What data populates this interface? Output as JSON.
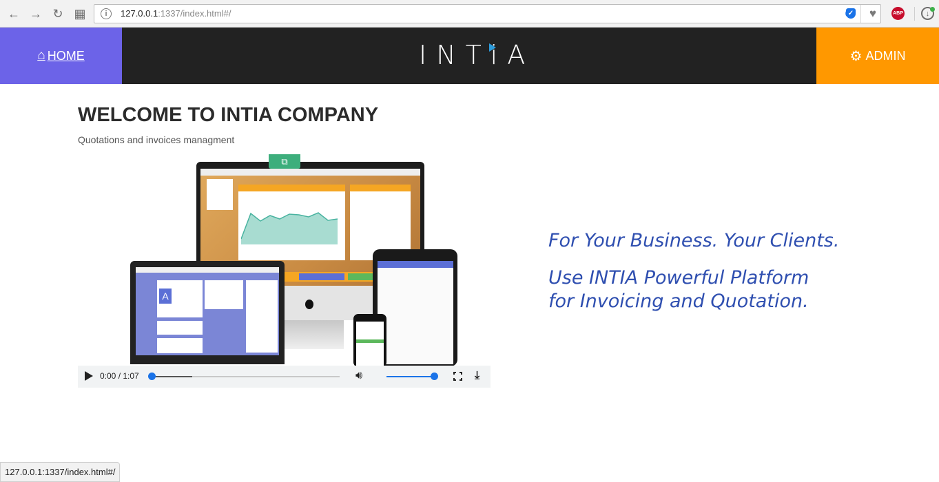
{
  "browser": {
    "back_icon": "←",
    "forward_icon": "→",
    "reload_icon": "↻",
    "apps_icon": "▦",
    "url_host": "127.0.0.1",
    "url_rest": ":1337/index.html#/",
    "ext_count": "0",
    "abp_label": "ABP",
    "status_url": "127.0.0.1:1337/index.html#/"
  },
  "header": {
    "home_label": "HOME",
    "logo_text": "INTiA",
    "admin_label": "ADMIN",
    "colors": {
      "home_bg": "#6c63e8",
      "bar_bg": "#222222",
      "admin_bg": "#ff9800"
    }
  },
  "main": {
    "title": "WELCOME TO INTIA COMPANY",
    "subtitle": "Quotations and invoices managment",
    "video": {
      "time": "0:00 / 1:07",
      "progress": 0,
      "buffered": 0.22,
      "volume": 1.0
    },
    "tagline_1": "For Your Business. Your Clients.",
    "tagline_2a": "Use INTIA Powerful Platform",
    "tagline_2b": "for Invoicing and Quotation."
  }
}
